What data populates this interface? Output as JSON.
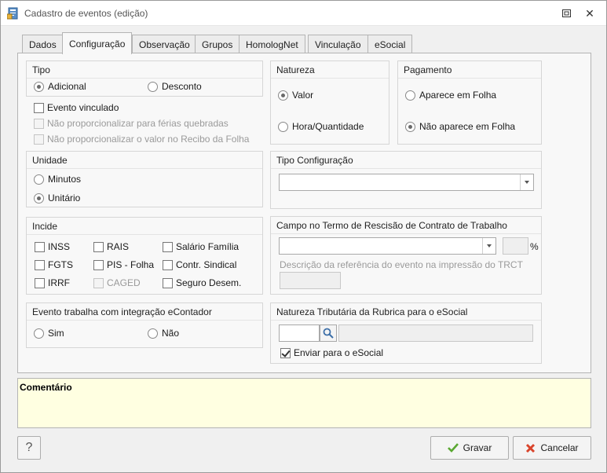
{
  "window": {
    "title": "Cadastro de eventos (edição)"
  },
  "tabs": [
    {
      "label": "Dados"
    },
    {
      "label": "Configuração"
    },
    {
      "label": "Observação"
    },
    {
      "label": "Grupos"
    },
    {
      "label": "HomologNet"
    },
    {
      "label": "Vinculação"
    },
    {
      "label": "eSocial"
    }
  ],
  "active_tab": "Configuração",
  "tipo": {
    "title": "Tipo",
    "options": [
      "Adicional",
      "Desconto"
    ],
    "selected": "Adicional"
  },
  "checks_top": [
    {
      "label": "Evento vinculado",
      "checked": false,
      "enabled": true
    },
    {
      "label": "Não proporcionalizar para férias quebradas",
      "checked": false,
      "enabled": false
    },
    {
      "label": "Não proporcionalizar o valor no Recibo da Folha",
      "checked": false,
      "enabled": false
    }
  ],
  "unidade": {
    "title": "Unidade",
    "options": [
      "Minutos",
      "Unitário"
    ],
    "selected": "Unitário"
  },
  "incide": {
    "title": "Incide",
    "items": [
      {
        "label": "INSS",
        "checked": false,
        "enabled": true
      },
      {
        "label": "RAIS",
        "checked": false,
        "enabled": true
      },
      {
        "label": "Salário Família",
        "checked": false,
        "enabled": true
      },
      {
        "label": "FGTS",
        "checked": false,
        "enabled": true
      },
      {
        "label": "PIS - Folha",
        "checked": false,
        "enabled": true
      },
      {
        "label": "Contr. Sindical",
        "checked": false,
        "enabled": true
      },
      {
        "label": "IRRF",
        "checked": false,
        "enabled": true
      },
      {
        "label": "CAGED",
        "checked": false,
        "enabled": false
      },
      {
        "label": "Seguro Desem.",
        "checked": false,
        "enabled": true
      }
    ]
  },
  "econtador": {
    "title": "Evento trabalha com integração eContador",
    "options": [
      "Sim",
      "Não"
    ],
    "selected": ""
  },
  "natureza": {
    "title": "Natureza",
    "options": [
      "Valor",
      "Hora/Quantidade"
    ],
    "selected": "Valor"
  },
  "pagamento": {
    "title": "Pagamento",
    "options": [
      "Aparece em Folha",
      "Não aparece em Folha"
    ],
    "selected": "Não aparece em Folha"
  },
  "tipo_config": {
    "title": "Tipo Configuração",
    "value": ""
  },
  "trct": {
    "title": "Campo no Termo de Rescisão de Contrato de Trabalho",
    "value": "",
    "percent_value": "",
    "percent_symbol": "%",
    "desc_label": "Descrição da referência do evento na impressão do TRCT",
    "desc_value": ""
  },
  "esocial": {
    "title": "Natureza Tributária da Rubrica para o eSocial",
    "code": "",
    "description": "",
    "send_label": "Enviar para o eSocial",
    "send_checked": true
  },
  "comment": {
    "label": "Comentário",
    "text": ""
  },
  "buttons": {
    "help": "?",
    "save": "Gravar",
    "cancel": "Cancelar"
  },
  "colors": {
    "comment_bg": "#ffffe1",
    "save_icon": "#5aa832",
    "cancel_icon": "#d9442b"
  }
}
